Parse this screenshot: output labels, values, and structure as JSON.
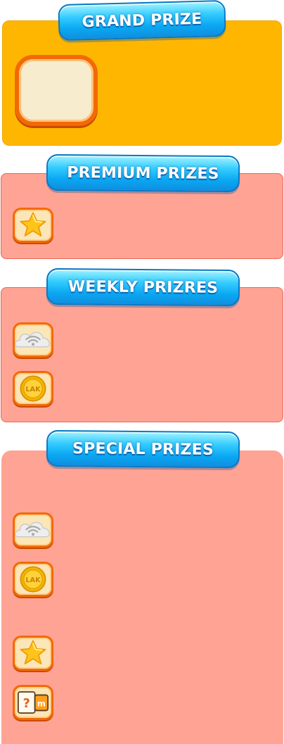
{
  "sections": {
    "grand": {
      "title": "GRAND PRIZE"
    },
    "premium": {
      "title": "PREMIUM PRIZES"
    },
    "weekly": {
      "title": "WEEKLY PRIZRES"
    },
    "special": {
      "title": "SPECIAL PRIZES"
    }
  },
  "icons": {
    "coin_label": "LAK",
    "mystery_label": "?",
    "brand_label": "m"
  },
  "colors": {
    "grand_panel": "#ffb600",
    "prize_panel": "#ffa394",
    "banner": "#0aa7f2",
    "frame_orange": "#f26a05"
  }
}
